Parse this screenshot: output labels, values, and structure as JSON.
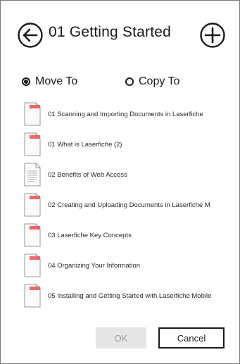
{
  "header": {
    "title": "01 Getting Started",
    "back_icon": "arrow-left-circle-icon",
    "add_icon": "plus-circle-icon"
  },
  "options": {
    "move_label": "Move To",
    "copy_label": "Copy To",
    "selected": "Move To"
  },
  "files": [
    {
      "label": "01 Scanning and Importing Documents in Laserfiche",
      "icon": "document-flag-icon"
    },
    {
      "label": "01 What is Laserfiche (2)",
      "icon": "document-flag-icon"
    },
    {
      "label": "02 Benefits of Web Access",
      "icon": "document-text-icon"
    },
    {
      "label": "02 Creating and Uploading Documents in Laserfiche M",
      "icon": "document-flag-icon"
    },
    {
      "label": "03 Laserfiche Key Concepts",
      "icon": "document-flag-icon"
    },
    {
      "label": "04 Organizing Your Information",
      "icon": "document-flag-icon"
    },
    {
      "label": "05 Installing and Getting Started with Laserfiche Mobile",
      "icon": "document-flag-icon"
    }
  ],
  "footer": {
    "ok_label": "OK",
    "cancel_label": "Cancel"
  },
  "colors": {
    "accent_flag": "#e9686a",
    "text": "#1a1a1a",
    "disabled_bg": "#e6e6e6",
    "disabled_text": "#9b9b9b",
    "border": "#7a7a7a"
  }
}
